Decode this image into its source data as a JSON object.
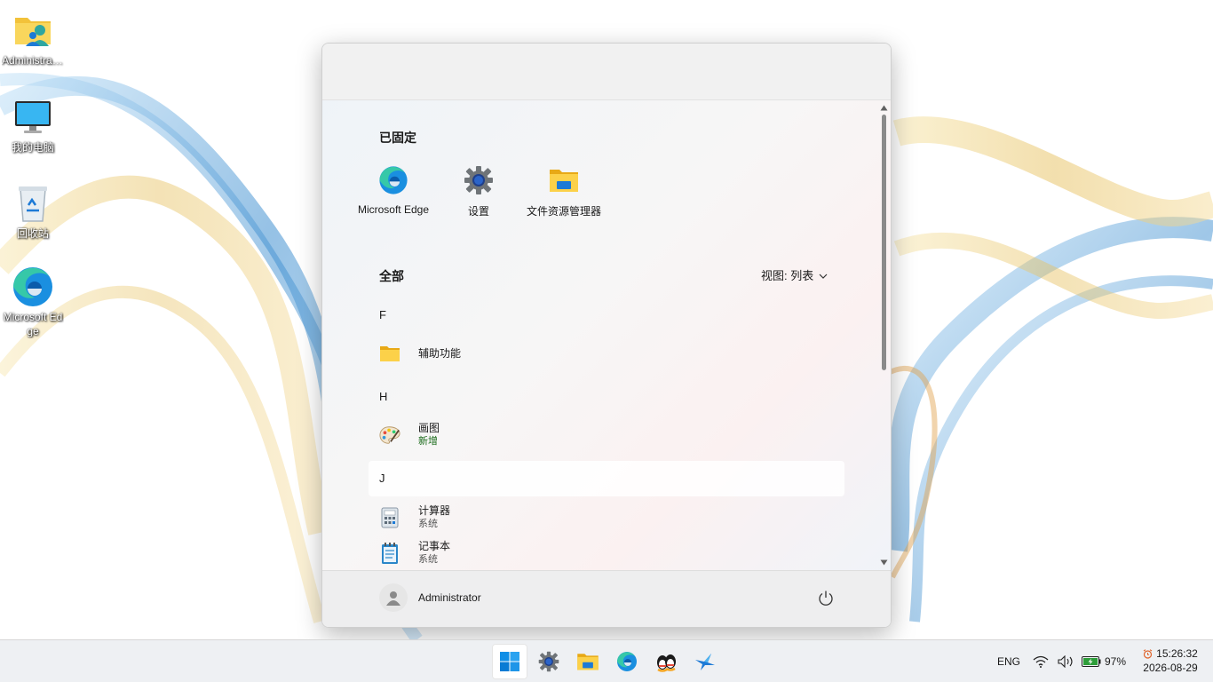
{
  "desktop": {
    "icons": [
      {
        "label": "Administrator",
        "icon": "user-folder-icon"
      },
      {
        "label": "我的电脑",
        "icon": "monitor-icon"
      },
      {
        "label": "回收站",
        "icon": "recycle-bin-icon"
      },
      {
        "label": "Microsoft Edge",
        "icon": "edge-icon"
      }
    ]
  },
  "start_menu": {
    "pinned_title": "已固定",
    "pinned": [
      {
        "label": "Microsoft Edge",
        "icon": "edge-icon"
      },
      {
        "label": "设置",
        "icon": "gear-icon"
      },
      {
        "label": "文件资源管理器",
        "icon": "folder-icon"
      }
    ],
    "all_title": "全部",
    "view_label": "视图: 列表",
    "groups": [
      {
        "letter": "F",
        "apps": [
          {
            "name": "辅助功能",
            "sub": "",
            "icon": "folder-icon"
          }
        ]
      },
      {
        "letter": "H",
        "apps": [
          {
            "name": "画图",
            "sub": "新增",
            "icon": "paint-palette-icon"
          }
        ]
      },
      {
        "letter": "J",
        "apps": [
          {
            "name": "计算器",
            "sub": "系统",
            "icon": "calculator-icon"
          },
          {
            "name": "记事本",
            "sub": "系统",
            "icon": "notepad-icon"
          }
        ]
      }
    ],
    "user_name": "Administrator"
  },
  "taskbar": {
    "apps": [
      "windows-start-icon",
      "gear-icon",
      "folder-icon",
      "edge-icon",
      "qq-penguin-icon",
      "bird-app-icon"
    ],
    "language": "ENG",
    "battery": "97%",
    "time": "15:26:32",
    "date": "2026-08-29"
  },
  "colors": {
    "accent": "#0078d4",
    "new_badge": "#1a6b1a",
    "wallpaper_blue": "#3f8fd0",
    "wallpaper_gold": "#e6bf5c"
  }
}
